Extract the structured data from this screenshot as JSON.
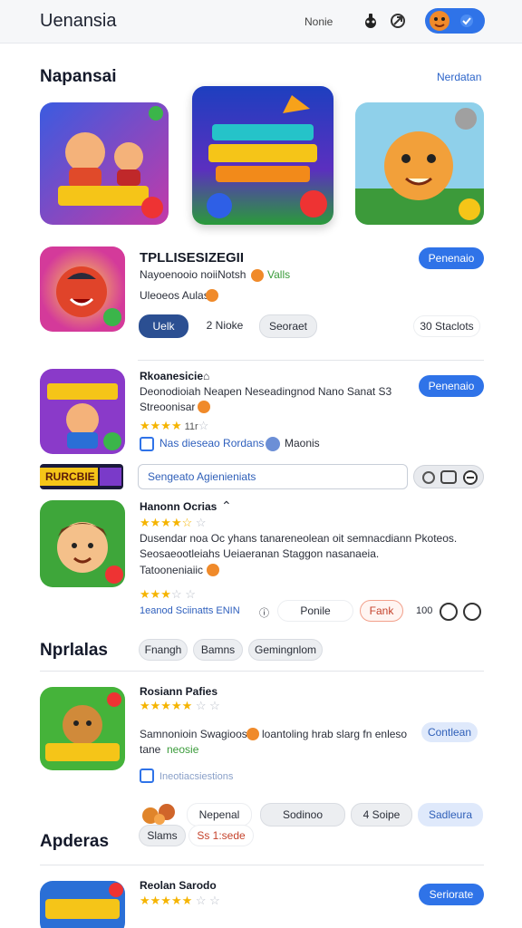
{
  "header": {
    "title": "Uenansia",
    "link": "Nonie"
  },
  "featured": {
    "title": "Napansai",
    "see_all": "Nerdatan"
  },
  "top_item": {
    "title": "TPLLISESIZEGII",
    "line1": "Nayoenooio noiiNotsh",
    "line1_tag": "Valls",
    "line2": "Uleoeos Aulas",
    "chips": [
      "Uelk",
      "2 Nioke",
      "Seoraet"
    ],
    "count": "30 Staclots",
    "action": "Penenaio"
  },
  "item2": {
    "title": "Rkoanesicie",
    "line1": "Deonodioiah Neapen Neseadingnod Nano Sanat S3",
    "line2": "Streoonisar",
    "rating_text": "11r",
    "tag": "Nas dieseao Rordans",
    "verified": "Maonis",
    "action": "Penenaio",
    "search": "Sengeato Agienieniats",
    "banner": "RURCBIE"
  },
  "item3": {
    "title": "Hanonn Ocrias",
    "line1": "Dusendar noa Oc yhans tanareneolean oit semnacdiann Pkoteos.",
    "line2": "Seosaeootleiahs Ueiaeranan Staggon nasanaeia.",
    "line3": "Tatooneniaiic",
    "link": "1eanod Sciinatts ENIN",
    "chips": [
      "Ponile",
      "Fank"
    ],
    "count": "100"
  },
  "popular": {
    "title": "Nprlalas",
    "chips": [
      "Fnangh",
      "Bamns",
      "Gemingnlom"
    ]
  },
  "item4": {
    "title": "Rosiann Pafies",
    "line1": "Samnonioin Swagioos",
    "line1b": "loantoling hrab slarg fn enleso",
    "line2": "tane",
    "line2_tag": "neosie",
    "action": "Contlean",
    "checkbox_label": "Ineotiacsiestions",
    "chips": [
      "Nepenal",
      "Sodinoo",
      "4 Soipe",
      "Sadleura",
      "Slams",
      "Ss 1:sede"
    ]
  },
  "updates": {
    "title": "Apderas"
  },
  "item5": {
    "title": "Reolan Sarodo",
    "action": "Seriorate"
  },
  "colors": {
    "accent": "#2f73e8",
    "star": "#f5b400",
    "dark_chip": "#2b4f92"
  }
}
